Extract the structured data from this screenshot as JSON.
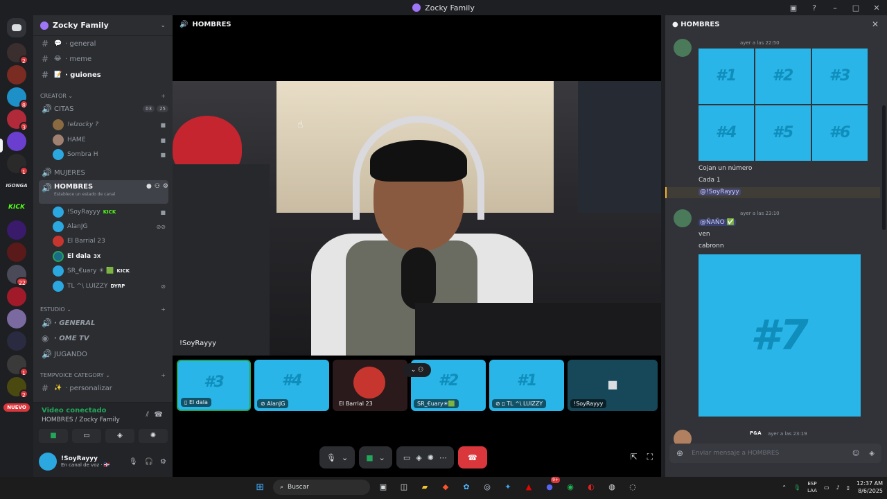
{
  "window": {
    "title": "Zocky Family"
  },
  "servers": {
    "badges": [
      "2",
      "8",
      "3",
      "1",
      "22",
      "1",
      "2"
    ],
    "text_icons": [
      "IGONGA",
      "KICK"
    ],
    "new_label": "NUEVO"
  },
  "guild": {
    "name": "Zocky Family",
    "channels_top": [
      {
        "emoji": "💬",
        "name": "· general"
      },
      {
        "emoji": "😂",
        "name": "· meme"
      },
      {
        "emoji": "📝",
        "name": "· guiones"
      }
    ],
    "creator_category": "CREATOR",
    "citas": {
      "name": "CITAS",
      "video_count": "03",
      "user_count": "25",
      "users": [
        {
          "name": "!elzocky ?"
        },
        {
          "name": "HAME"
        },
        {
          "name": "Sombra H"
        }
      ]
    },
    "mujeres": "MUJERES",
    "hombres": {
      "name": "HOMBRES",
      "status": "Establece un estado de canal",
      "users": [
        {
          "name": "!SoyRayyy",
          "tag": "KICK",
          "color": "#2ba8e0"
        },
        {
          "name": "AlanJG",
          "tag": "",
          "color": "#2ba8e0"
        },
        {
          "name": "El Barrial 23",
          "tag": "",
          "color": "#c7362e"
        },
        {
          "name": "El dala",
          "tag": "3X",
          "color": "#1a6a8a"
        },
        {
          "name": "SR_€uary ☀ 🟩",
          "tag": "KICK",
          "color": "#2ba8e0"
        },
        {
          "name": "TL ^\\ LUIZZY",
          "tag": "DYRP",
          "color": "#2ba8e0"
        }
      ]
    },
    "estudio_category": "ESTUDIO",
    "estudio_channels": [
      {
        "name": "· GENERAL"
      },
      {
        "name": "· OME TV"
      },
      {
        "name": "JUGANDO"
      }
    ],
    "tempvoice_category": "TEMPVOICE CATEGORY",
    "tempvoice_channels": [
      {
        "emoji": "✨",
        "name": "· personalizar"
      }
    ]
  },
  "voice_panel": {
    "status": "Video conectado",
    "location": "HOMBRES / Zocky Family",
    "user_name": "!SoyRayyy",
    "user_status": "En canal de voz · 🇩🇴"
  },
  "stage": {
    "channel": "HOMBRES",
    "main_label": "!SoyRayyy",
    "tiles": [
      {
        "num": "#3",
        "label": "El dala",
        "kind": "blue",
        "selected": true
      },
      {
        "num": "#4",
        "label": "AlanJG",
        "kind": "blue"
      },
      {
        "num": "",
        "label": "El Barrial 23",
        "kind": "avatar"
      },
      {
        "num": "#2",
        "label": "SR_€uary☀🟩",
        "kind": "blue"
      },
      {
        "num": "#1",
        "label": "TL ^\\ LUIZZY",
        "kind": "blue"
      },
      {
        "num": "",
        "label": "!SoyRayyy",
        "kind": "cam"
      }
    ]
  },
  "chat": {
    "channel": "HOMBRES",
    "messages": [
      {
        "time": "ayer a las 22:50",
        "grid": [
          "#1",
          "#2",
          "#3",
          "#4",
          "#5",
          "#6"
        ],
        "lines": [
          "Cojan un número",
          "Cada 1"
        ],
        "mention": "@!SoyRayyy"
      },
      {
        "time": "ayer a las 23:10",
        "mention": "@ÑAÑO ✅",
        "lines": [
          "ven",
          "cabronn"
        ],
        "image": "#7"
      },
      {
        "time": "ayer a las 23:19",
        "tag": "P&A"
      }
    ],
    "input_placeholder": "Enviar mensaje a HOMBRES"
  },
  "taskbar": {
    "search": "Buscar",
    "lang_top": "ESP",
    "lang_bottom": "LAA",
    "time": "12:37 AM",
    "date": "8/6/2025",
    "discord_badge": "9+"
  }
}
